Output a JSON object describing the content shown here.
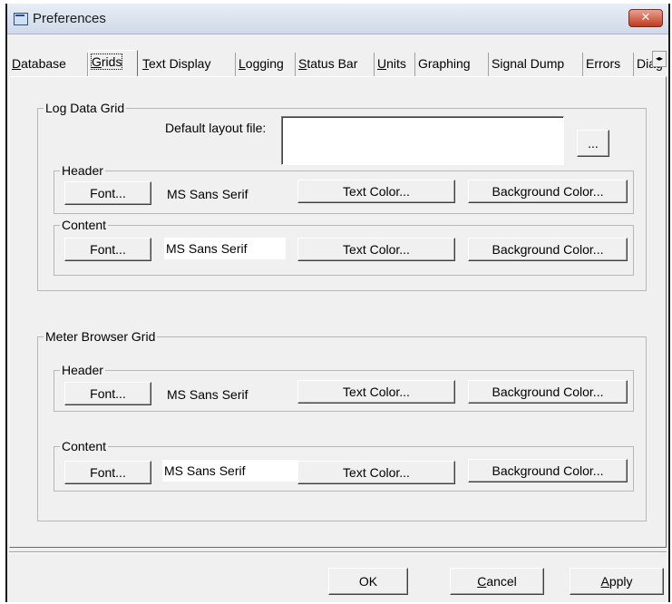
{
  "window": {
    "title": "Preferences",
    "close_glyph": "✕"
  },
  "tabs": [
    {
      "pre": "",
      "key": "D",
      "post": "atabase",
      "active": false
    },
    {
      "pre": "",
      "key": "G",
      "post": "rids",
      "active": true
    },
    {
      "pre": "",
      "key": "T",
      "post": "ext Display",
      "active": false
    },
    {
      "pre": "",
      "key": "L",
      "post": "ogging",
      "active": false
    },
    {
      "pre": "",
      "key": "S",
      "post": "tatus Bar",
      "active": false
    },
    {
      "pre": "",
      "key": "U",
      "post": "nits",
      "active": false
    },
    {
      "pre": "",
      "key": "",
      "post": "Graphing",
      "active": false
    },
    {
      "pre": "",
      "key": "",
      "post": "Signal Dump",
      "active": false
    },
    {
      "pre": "",
      "key": "",
      "post": "Errors",
      "active": false
    },
    {
      "pre": "",
      "key": "",
      "post": "Diag",
      "active": false
    }
  ],
  "tab_scroll_glyph": "◂▸",
  "log_grid": {
    "title": "Log Data Grid",
    "layout_label": "Default layout file:",
    "layout_value": "",
    "browse_label": "...",
    "header": {
      "title": "Header",
      "font_button": "Font...",
      "font_name": "MS Sans Serif",
      "text_color_button": "Text Color...",
      "bg_color_button": "Background Color..."
    },
    "content": {
      "title": "Content",
      "font_button": "Font...",
      "font_name": "MS Sans Serif",
      "text_color_button": "Text Color...",
      "bg_color_button": "Background Color..."
    }
  },
  "meter_grid": {
    "title": "Meter Browser Grid",
    "header": {
      "title": "Header",
      "font_button": "Font...",
      "font_name": "MS Sans Serif",
      "text_color_button": "Text Color...",
      "bg_color_button": "Background Color..."
    },
    "content": {
      "title": "Content",
      "font_button": "Font...",
      "font_name": "MS Sans Serif",
      "text_color_button": "Text Color...",
      "bg_color_button": "Background Color..."
    }
  },
  "footer": {
    "ok_label": "OK",
    "cancel_key": "C",
    "cancel_rest": "ancel",
    "apply_key": "A",
    "apply_rest": "pply"
  },
  "colors": {
    "face": "#f0f0f0",
    "close_red": "#c0391f"
  }
}
